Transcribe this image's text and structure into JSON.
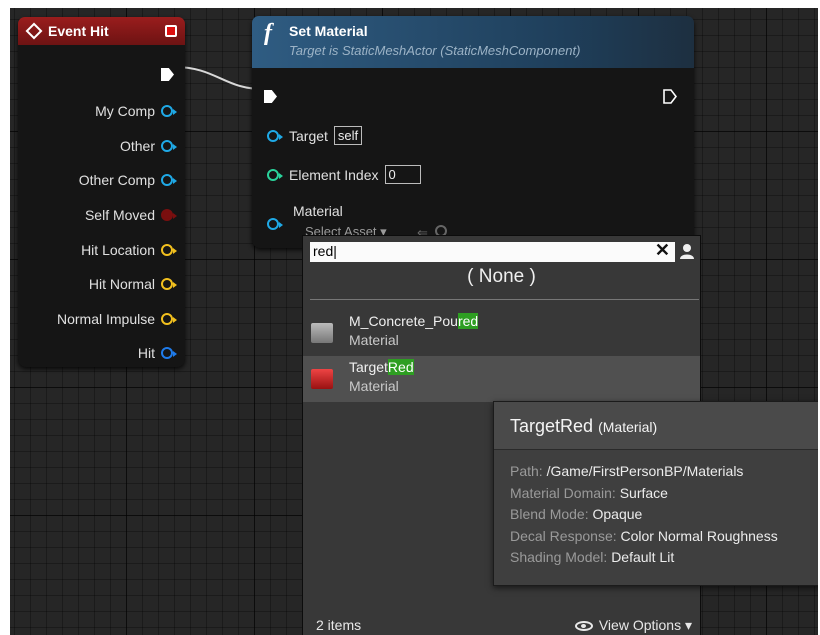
{
  "event_node": {
    "title": "Event Hit",
    "pins": [
      {
        "label": "My Comp",
        "color": "#1fa9e6"
      },
      {
        "label": "Other",
        "color": "#1fa9e6"
      },
      {
        "label": "Other Comp",
        "color": "#1fa9e6"
      },
      {
        "label": "Self Moved",
        "color": "#7a0f0f"
      },
      {
        "label": "Hit Location",
        "color": "#f2c01e"
      },
      {
        "label": "Hit Normal",
        "color": "#f2c01e"
      },
      {
        "label": "Normal Impulse",
        "color": "#f2c01e"
      },
      {
        "label": "Hit",
        "color": "#1f7bea"
      }
    ]
  },
  "function_node": {
    "icon": "f",
    "title": "Set Material",
    "subtitle": "Target is StaticMeshActor (StaticMeshComponent)",
    "target_label": "Target",
    "target_value": "self",
    "element_index_label": "Element Index",
    "element_index_value": "0",
    "material_label": "Material",
    "select_asset_label": "Select Asset ▾",
    "colors": {
      "object_pin": "#1fa9e6",
      "int_pin": "#2ad39b"
    }
  },
  "asset_picker": {
    "search_value": "red|",
    "none_label": "( None )",
    "assets": [
      {
        "name_prefix": "M_Concrete_Pou",
        "name_match": "red",
        "type": "Material"
      },
      {
        "name_prefix": "Target",
        "name_match": "Red",
        "type": "Material"
      }
    ],
    "item_count": "2 items",
    "view_options_label": "View Options ▾"
  },
  "tooltip": {
    "name": "TargetRed",
    "type": "(Material)",
    "rows": [
      {
        "label": "Path:",
        "value": "/Game/FirstPersonBP/Materials"
      },
      {
        "label": "Material Domain:",
        "value": "Surface"
      },
      {
        "label": "Blend Mode:",
        "value": "Opaque"
      },
      {
        "label": "Decal Response:",
        "value": "Color Normal Roughness"
      },
      {
        "label": "Shading Model:",
        "value": "Default Lit"
      }
    ]
  }
}
